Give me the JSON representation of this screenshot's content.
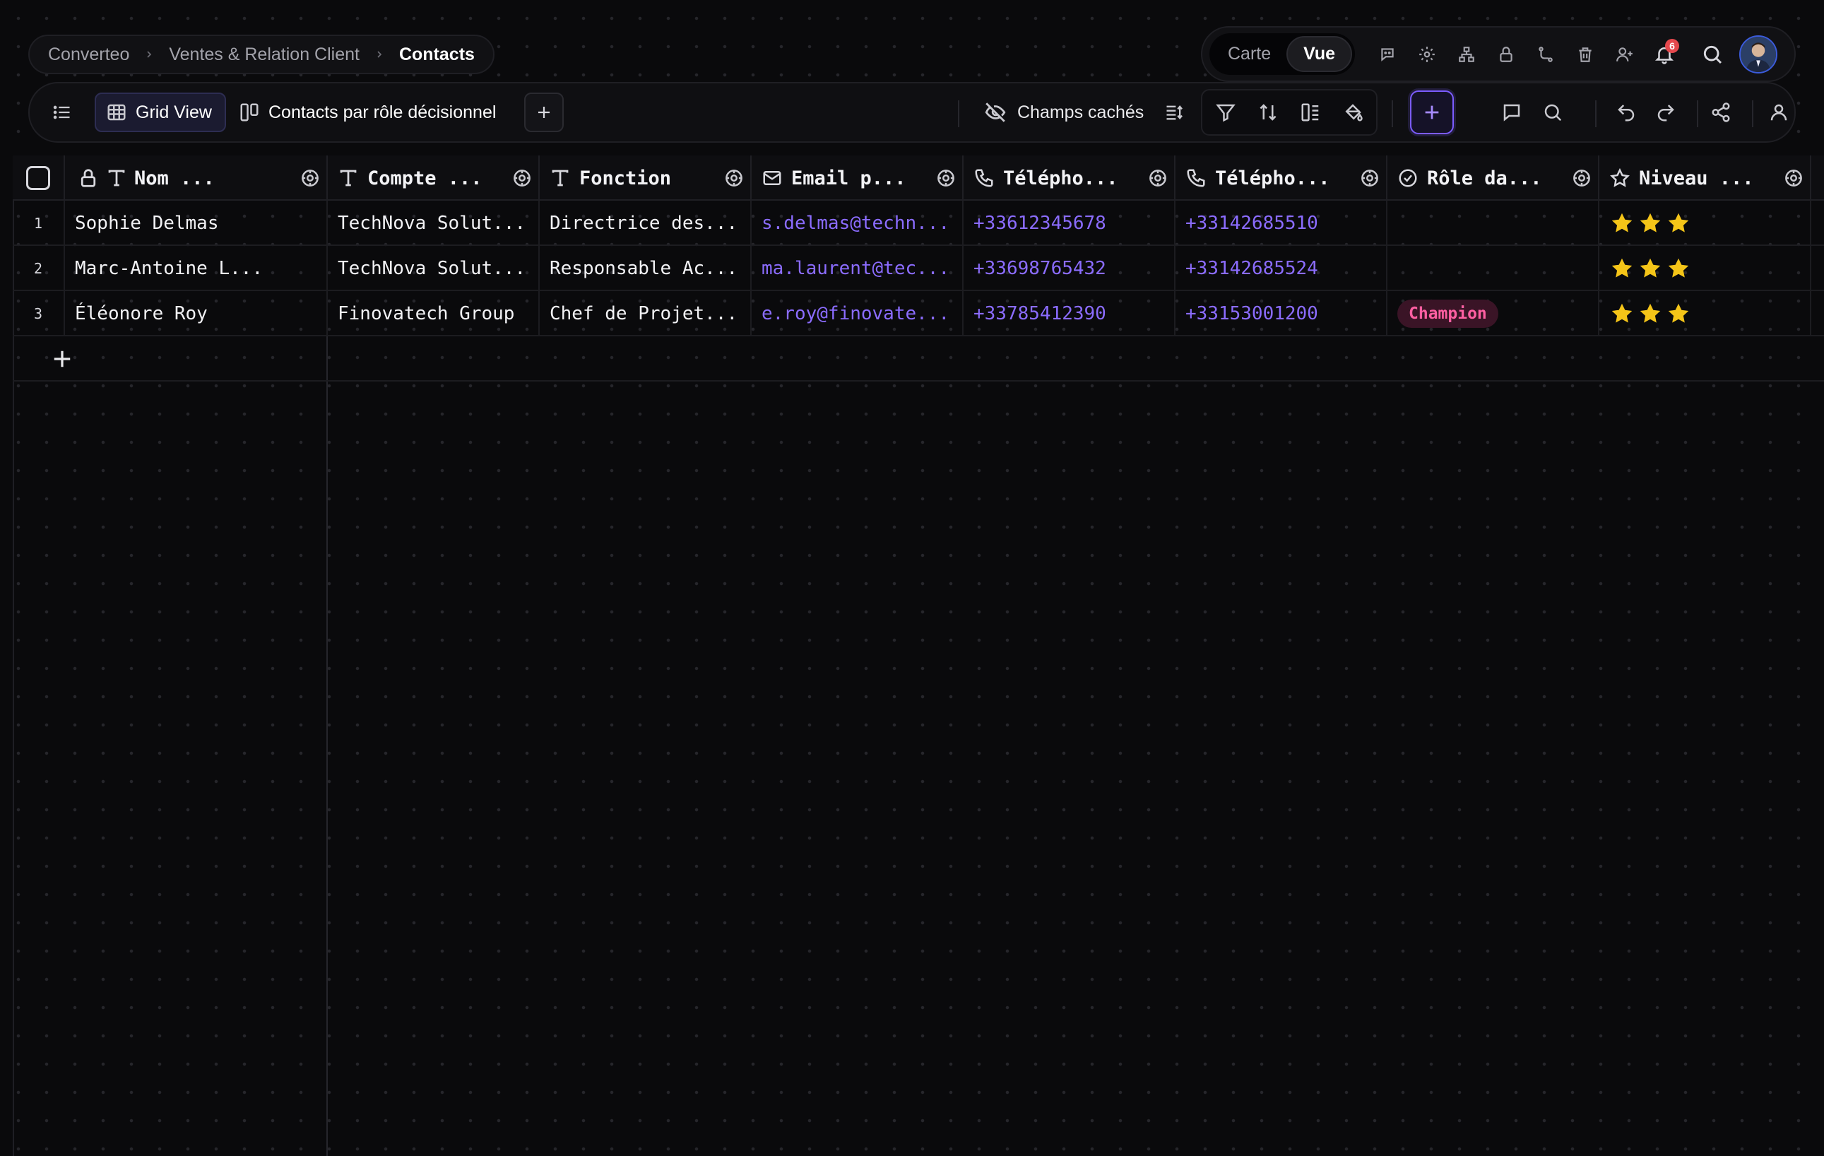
{
  "breadcrumb": {
    "items": [
      "Converteo",
      "Ventes & Relation Client"
    ],
    "current": "Contacts"
  },
  "view_switch": {
    "options": [
      "Carte",
      "Vue"
    ],
    "active": "Vue"
  },
  "topbar": {
    "icons": [
      "chat-bot-icon",
      "gear-icon",
      "hierarchy-icon",
      "lock-icon",
      "workflow-icon",
      "trash-icon",
      "add-user-icon",
      "bell-icon",
      "search-icon"
    ],
    "notifications_count": "6"
  },
  "toolbar": {
    "views": [
      {
        "label": "Grid View",
        "icon": "grid-icon",
        "active": true
      },
      {
        "label": "Contacts par rôle décisionnel",
        "icon": "kanban-icon",
        "active": false
      }
    ],
    "hidden_fields_label": "Champs cachés",
    "accent_color": "#7c5cff"
  },
  "table": {
    "columns": [
      {
        "label": "Nom ...",
        "icon": "text-icon",
        "locked": true
      },
      {
        "label": "Compte ...",
        "icon": "text-icon"
      },
      {
        "label": "Fonction",
        "icon": "text-icon"
      },
      {
        "label": "Email p...",
        "icon": "mail-icon"
      },
      {
        "label": "Télépho...",
        "icon": "phone-icon"
      },
      {
        "label": "Télépho...",
        "icon": "phone-icon"
      },
      {
        "label": "Rôle da...",
        "icon": "check-circle-icon"
      },
      {
        "label": "Niveau ...",
        "icon": "star-icon"
      }
    ],
    "rows": [
      {
        "num": "1",
        "name": "Sophie Delmas",
        "account": "TechNova Solut...",
        "role": "Directrice des...",
        "email": "s.delmas@techn...",
        "phone1": "+33612345678",
        "phone2": "+33142685510",
        "decision_role": "",
        "level": 3
      },
      {
        "num": "2",
        "name": "Marc-Antoine L...",
        "account": "TechNova Solut...",
        "role": "Responsable Ac...",
        "email": "ma.laurent@tec...",
        "phone1": "+33698765432",
        "phone2": "+33142685524",
        "decision_role": "",
        "level": 3
      },
      {
        "num": "3",
        "name": "Éléonore Roy",
        "account": "Finovatech Group",
        "role": "Chef de Projet...",
        "email": "e.roy@finovate...",
        "phone1": "+33785412390",
        "phone2": "+33153001200",
        "decision_role": "Champion",
        "level": 3
      }
    ],
    "link_color": "#8b6cff",
    "chip_color": "#ff5fa2",
    "star_color": "#f5c518"
  }
}
